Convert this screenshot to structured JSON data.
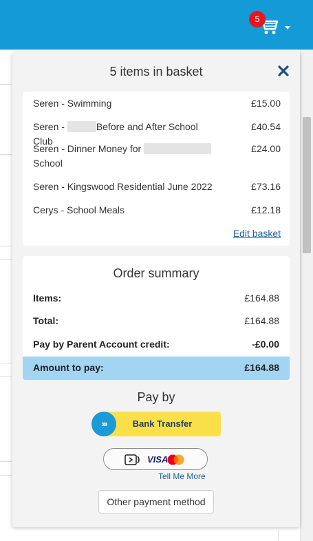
{
  "header": {
    "cart_count": "5",
    "cart_icon": "shopping-cart-icon"
  },
  "basket": {
    "title": "5 items in basket",
    "close_icon": "close-x-icon",
    "items": [
      {
        "name": "Seren - Swimming",
        "price": "£15.00"
      },
      {
        "name_prefix": "Seren - ",
        "name_suffix": "Before and After School Club",
        "price": "£40.54"
      },
      {
        "name_prefix": "Seren - Dinner Money for ",
        "name_line2": "School",
        "price": "£24.00"
      },
      {
        "name": "Seren - Kingswood Residential June 2022",
        "price": "£73.16"
      },
      {
        "name": "Cerys - School Meals",
        "price": "£12.18"
      }
    ],
    "edit_link": "Edit basket"
  },
  "summary": {
    "title": "Order summary",
    "items_label": "Items:",
    "items_value": "£164.88",
    "total_label": "Total:",
    "total_value": "£164.88",
    "credit_label": "Pay by Parent Account credit:",
    "credit_value": "-£0.00",
    "amount_label": "Amount to pay:",
    "amount_value": "£164.88"
  },
  "payment": {
    "title": "Pay by",
    "bank_transfer_label": "Bank Transfer",
    "bank_icon": "chevrons-right-icon",
    "card_visa_text": "VISA",
    "tell_me_more": "Tell Me More",
    "other_method": "Other payment method"
  },
  "colors": {
    "header_blue": "#149bd7",
    "badge_red": "#e8141e",
    "amount_highlight": "#a3d4f1",
    "bank_yellow": "#f9e04b",
    "link_blue": "#1a5fa8"
  }
}
